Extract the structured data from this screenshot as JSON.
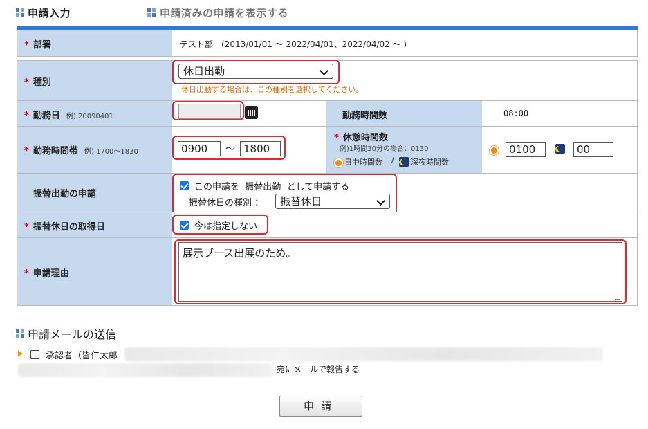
{
  "tabs": {
    "input": "申請入力",
    "show_submitted": "申請済みの申請を表示する"
  },
  "form": {
    "required_mark": "*",
    "department": {
      "label": "部署",
      "value": "テスト部　(2013/01/01 ～ 2022/04/01、2022/04/02 ～ )"
    },
    "type": {
      "label": "種別",
      "selected": "休日出勤",
      "note": "休日出勤する場合は、この種別を選択してください。"
    },
    "work_date": {
      "label": "勤務日",
      "example": "例) 20090401",
      "value": ""
    },
    "work_hours": {
      "label": "勤務時間数",
      "value": "08:00"
    },
    "work_time": {
      "label": "勤務時間帯",
      "example": "例) 1700～1830",
      "start": "0900",
      "separator": "～",
      "end": "1800"
    },
    "break_time": {
      "label": "休憩時間数",
      "example": "例)1時間30分の場合：0130",
      "day_label": "日中時間数",
      "slash": "/",
      "night_label": "深夜時間数",
      "day_value": "0100",
      "night_value": "00"
    },
    "substitute_request": {
      "label": "振替出勤の申請",
      "checkbox_text_pre": "この申請を",
      "checkbox_text_kind": "振替出勤",
      "checkbox_text_post": "として申請する",
      "checked": true,
      "kind_label": "振替休日の種別 ：",
      "kind_selected": "振替休日"
    },
    "substitute_holiday": {
      "label": "振替休日の取得日",
      "checkbox_text": "今は指定しない",
      "checked": true
    },
    "reason": {
      "label": "申請理由",
      "value": "展示ブース出展のため。"
    }
  },
  "mail": {
    "title": "申請メールの送信",
    "approver_prefix": "承認者（皆仁太郎",
    "suffix": "宛にメールで報告する",
    "checked": false
  },
  "submit_label": "申請",
  "colors": {
    "label_bg": "#c7d9ef",
    "accent_bar": "#2f78d8",
    "required": "#e0001a",
    "note": "#e07000",
    "highlight_border": "#e8262f",
    "checkbox": "#1a73e8"
  }
}
